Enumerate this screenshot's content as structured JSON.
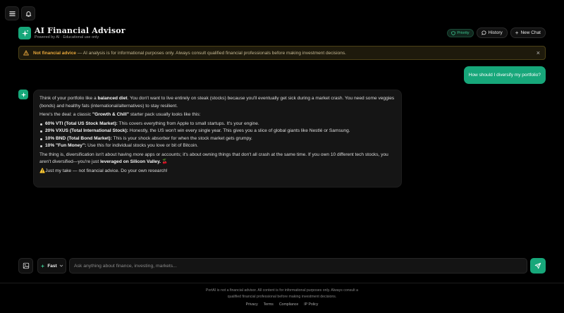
{
  "header": {
    "title": "AI Financial Advisor",
    "subtitle": "Powered by AI · Educational use only",
    "priority_label": "Priority",
    "history_label": "History",
    "new_chat_label": "New Chat"
  },
  "disclaimer": {
    "title": "Not financial advice",
    "text": " — AI analysis is for informational purposes only. Always consult qualified financial professionals before making investment decisions.",
    "close_label": "×"
  },
  "conversation": {
    "user_message": "How should I diversify my portfolio?",
    "ai": {
      "p1_a": "Think of your portfolio like a ",
      "p1_b": "balanced diet",
      "p1_c": ". You don't want to live entirely on steak (stocks) because you'll eventually get sick during a market crash. You need some veggies (bonds) and healthy fats (international/alternatives) to stay resilient.",
      "p2_a": "Here's the deal: a classic ",
      "p2_b": "\"Growth & Chill\"",
      "p2_c": " starter pack usually looks like this:",
      "bullets": [
        {
          "bold": "60% VTI (Total US Stock Market):",
          "text": " This covers everything from Apple to small startups. It's your engine."
        },
        {
          "bold": "20% VXUS (Total International Stock):",
          "text": " Honestly, the US won't win every single year. This gives you a slice of global giants like Nestlé or Samsung."
        },
        {
          "bold": "10% BND (Total Bond Market):",
          "text": " This is your shock absorber for when the stock market gets grumpy."
        },
        {
          "bold": "10% \"Fun Money\":",
          "text": " Use this for individual stocks you love or bit of Bitcoin."
        }
      ],
      "p3_a": "The thing is, diversification isn't about having ",
      "p3_b": "more",
      "p3_c": " apps or accounts; it's about owning things that don't all crash at the same time. If you own 10 different tech stocks, you aren't diversified—you're just ",
      "p3_d": "leveraged on Silicon Valley.",
      "p3_e": " 🍒",
      "p4_icon": "⚠️",
      "p4_text": "Just my take — not financial advice. Do your own research!"
    }
  },
  "input": {
    "mode_label": "Fast",
    "placeholder": "Ask anything about finance, investing, markets..."
  },
  "footer": {
    "text_line1": "PortAI is not a financial advisor. All content is for informational purposes only. Always consult a",
    "text_line2": "qualified financial professional before making investment decisions.",
    "links": [
      "Privacy",
      "Terms",
      "Compliance",
      "IP Policy"
    ]
  },
  "colors": {
    "accent": "#17a77a",
    "warning": "#e9a83c",
    "background": "#000000"
  }
}
